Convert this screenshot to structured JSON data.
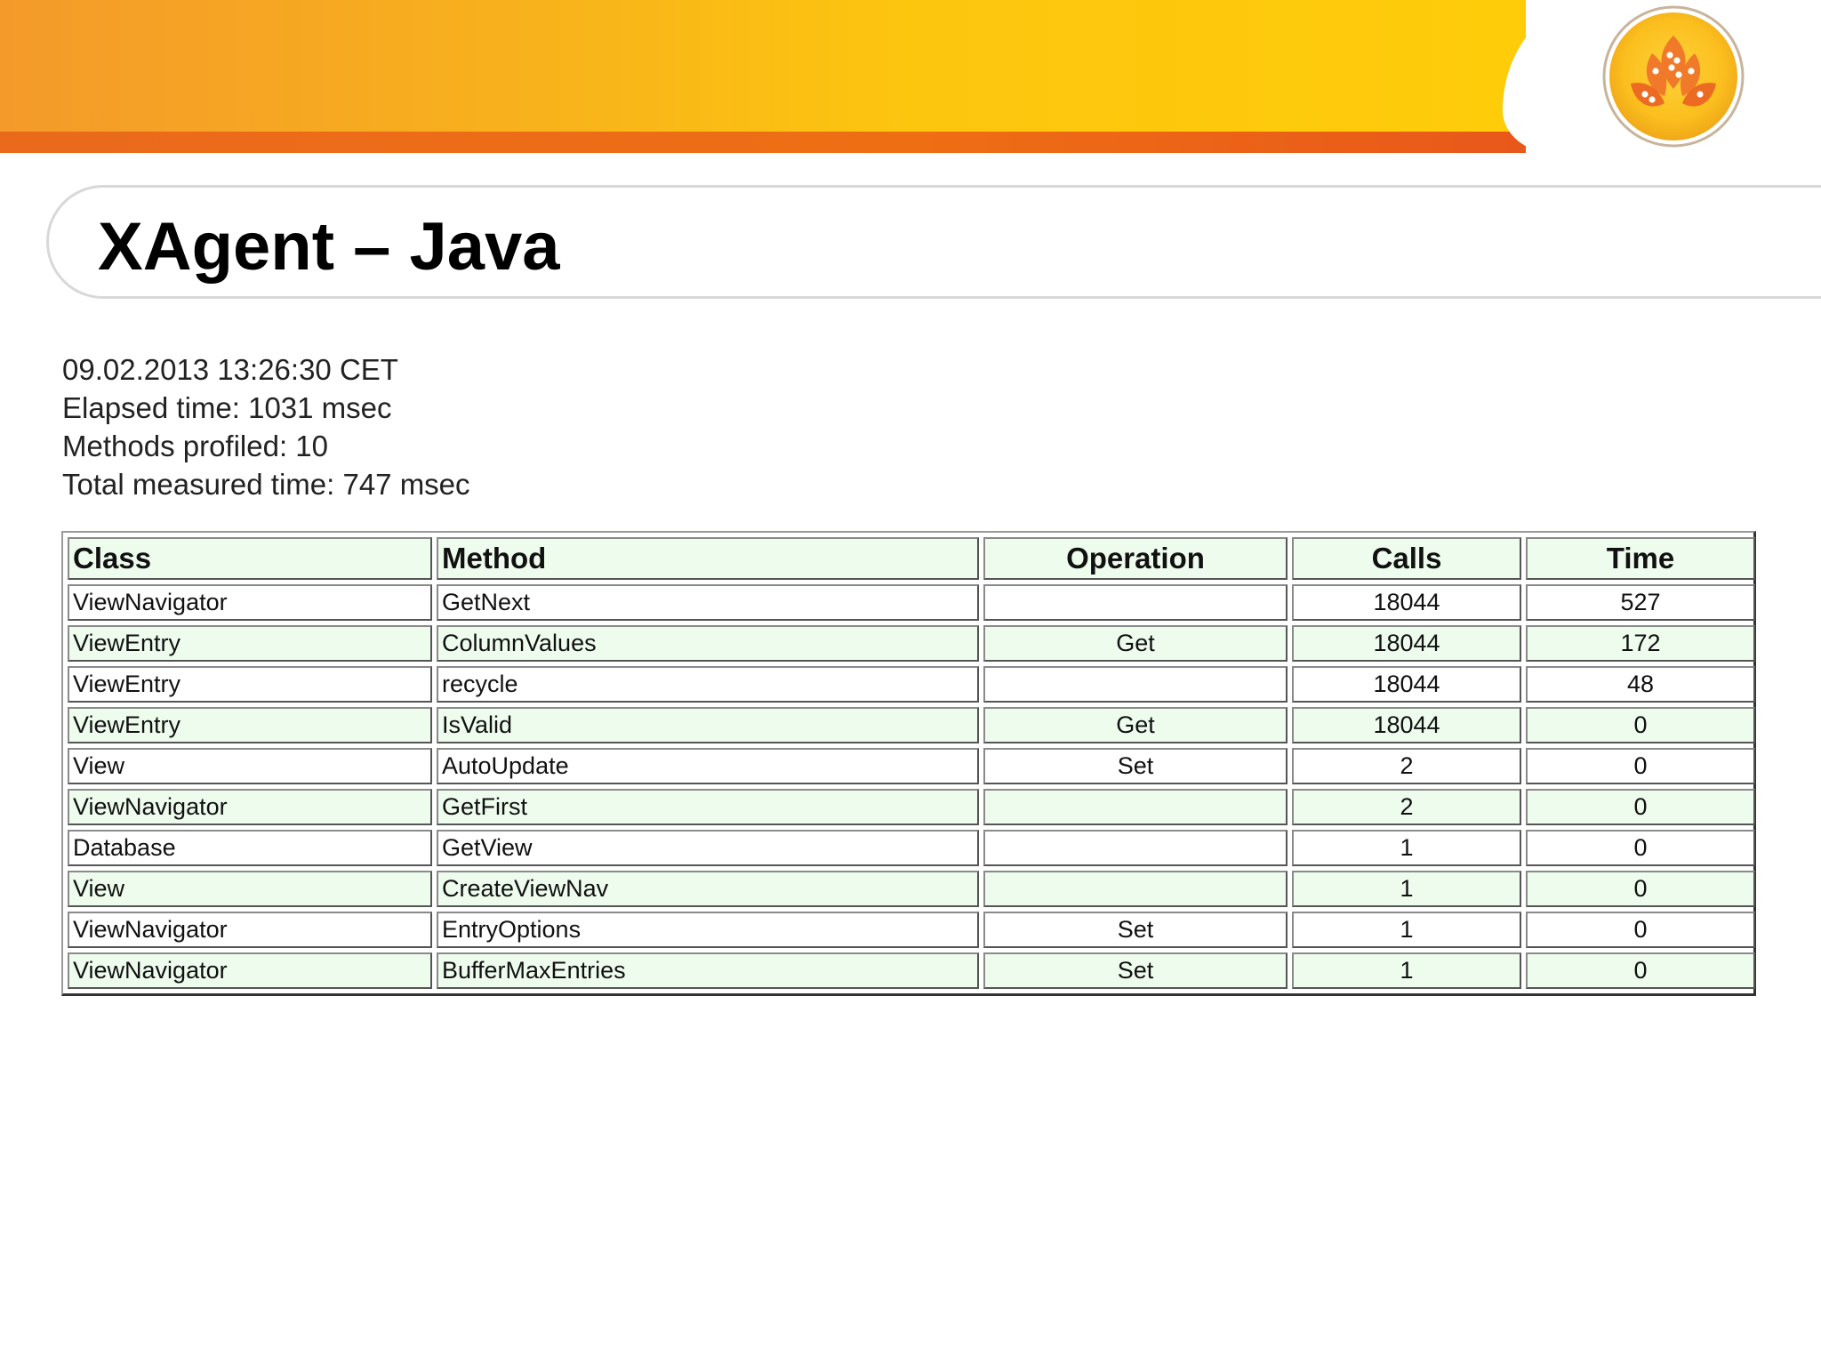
{
  "slide": {
    "title": "XAgent – Java"
  },
  "info": {
    "timestamp": "09.02.2013 13:26:30 CET",
    "elapsed": "Elapsed time: 1031 msec",
    "methods": "Methods profiled: 10",
    "total": "Total measured time: 747 msec"
  },
  "table": {
    "headers": [
      "Class",
      "Method",
      "Operation",
      "Calls",
      "Time"
    ],
    "rows": [
      [
        "ViewNavigator",
        "GetNext",
        "",
        "18044",
        "527"
      ],
      [
        "ViewEntry",
        "ColumnValues",
        "Get",
        "18044",
        "172"
      ],
      [
        "ViewEntry",
        "recycle",
        "",
        "18044",
        "48"
      ],
      [
        "ViewEntry",
        "IsValid",
        "Get",
        "18044",
        "0"
      ],
      [
        "View",
        "AutoUpdate",
        "Set",
        "2",
        "0"
      ],
      [
        "ViewNavigator",
        "GetFirst",
        "",
        "2",
        "0"
      ],
      [
        "Database",
        "GetView",
        "",
        "1",
        "0"
      ],
      [
        "View",
        "CreateViewNav",
        "",
        "1",
        "0"
      ],
      [
        "ViewNavigator",
        "EntryOptions",
        "Set",
        "1",
        "0"
      ],
      [
        "ViewNavigator",
        "BufferMaxEntries",
        "Set",
        "1",
        "0"
      ]
    ]
  },
  "colors": {
    "banner_start": "#f49a2a",
    "banner_end": "#ffcc0a",
    "strip": "#ea6a1c",
    "row_tint": "#eefcee"
  },
  "icons": {
    "logo": "lotus-flower-logo-icon"
  }
}
